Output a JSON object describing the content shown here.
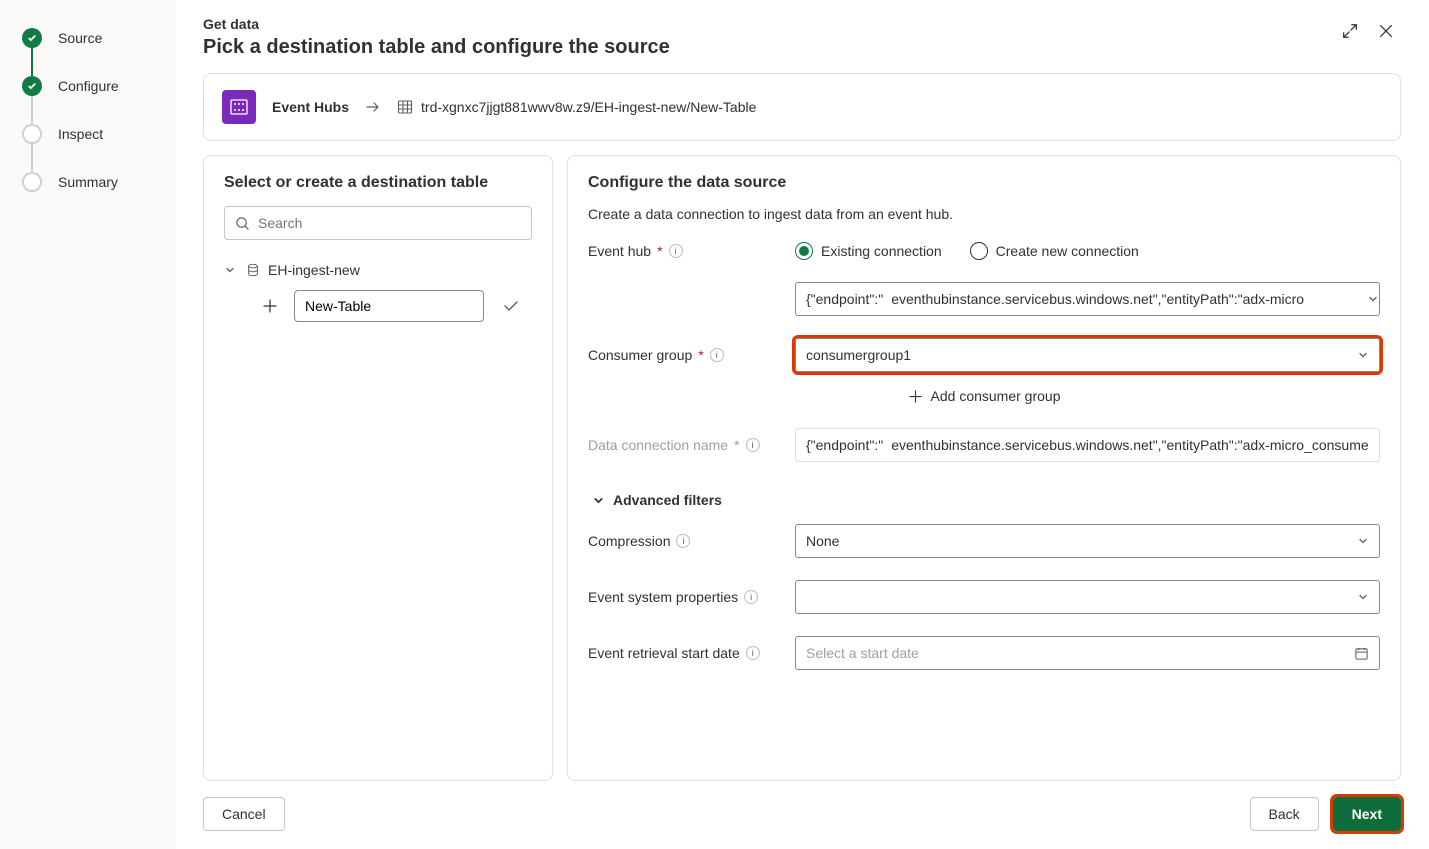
{
  "sidebar": {
    "steps": [
      {
        "label": "Source",
        "state": "done"
      },
      {
        "label": "Configure",
        "state": "current"
      },
      {
        "label": "Inspect",
        "state": "pending"
      },
      {
        "label": "Summary",
        "state": "pending"
      }
    ]
  },
  "header": {
    "supertitle": "Get data",
    "title": "Pick a destination table and configure the source"
  },
  "breadcrumb": {
    "source_label": "Event Hubs",
    "path": "trd-xgnxc7jjgt881wwv8w.z9/EH-ingest-new/New-Table"
  },
  "left": {
    "title": "Select or create a destination table",
    "search_placeholder": "Search",
    "db_name": "EH-ingest-new",
    "new_table_value": "New-Table"
  },
  "right": {
    "title": "Configure the data source",
    "subtitle": "Create a data connection to ingest data from an event hub.",
    "event_hub_label": "Event hub",
    "radio_existing": "Existing connection",
    "radio_create": "Create new connection",
    "eh_prefix": "{\"endpoint\":\"",
    "eh_value": "eventhubinstance.servicebus.windows.net\",\"entityPath\":\"adx-micro",
    "consumer_group_label": "Consumer group",
    "consumer_group_value": "consumergroup1",
    "add_consumer_label": "Add consumer group",
    "conn_name_label": "Data connection name",
    "conn_prefix": "{\"endpoint\":\"",
    "conn_value": "eventhubinstance.servicebus.windows.net\",\"entityPath\":\"adx-micro_consume",
    "adv_filters": "Advanced filters",
    "compression_label": "Compression",
    "compression_value": "None",
    "evprops_label": "Event system properties",
    "evprops_value": "",
    "evdate_label": "Event retrieval start date",
    "evdate_placeholder": "Select a start date"
  },
  "footer": {
    "cancel": "Cancel",
    "back": "Back",
    "next": "Next"
  }
}
